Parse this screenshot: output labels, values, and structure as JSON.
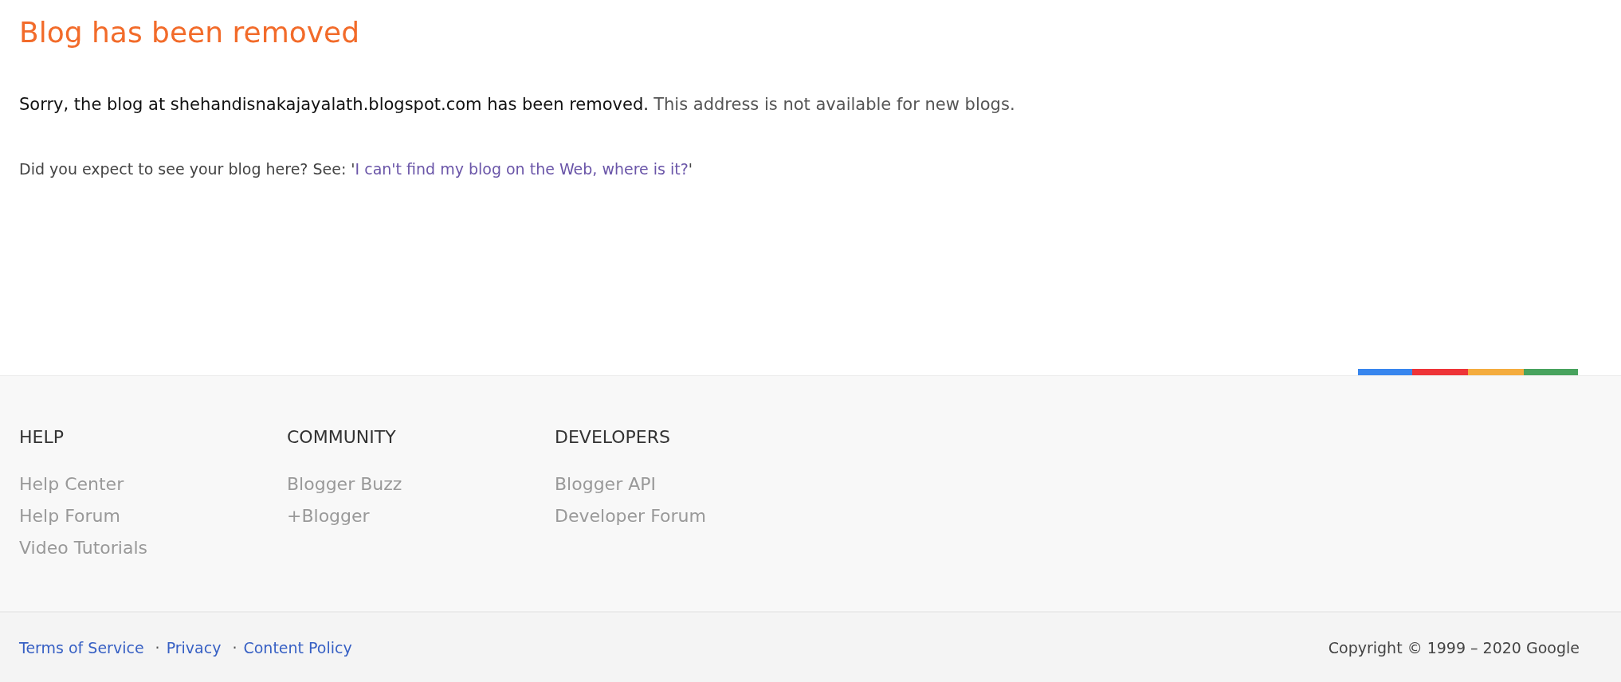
{
  "title": "Blog has been removed",
  "message": {
    "primary": "Sorry, the blog at shehandisnakajayalath.blogspot.com has been removed.",
    "secondary": "This address is not available for new blogs."
  },
  "help_line": {
    "prefix": "Did you expect to see your blog here? See: '",
    "link": "I can't find my blog on the Web, where is it?",
    "suffix": "'"
  },
  "footer_columns": [
    {
      "heading": "HELP",
      "links": [
        "Help Center",
        "Help Forum",
        "Video Tutorials"
      ]
    },
    {
      "heading": "COMMUNITY",
      "links": [
        "Blogger Buzz",
        "+Blogger"
      ]
    },
    {
      "heading": "DEVELOPERS",
      "links": [
        "Blogger API",
        "Developer Forum"
      ]
    }
  ],
  "legal_links": [
    {
      "label": "Terms of Service"
    },
    {
      "separator": "·",
      "label": "Privacy"
    },
    {
      "separator": "·",
      "label": "Content Policy"
    }
  ],
  "copyright": "Copyright © 1999 – 2020 Google"
}
